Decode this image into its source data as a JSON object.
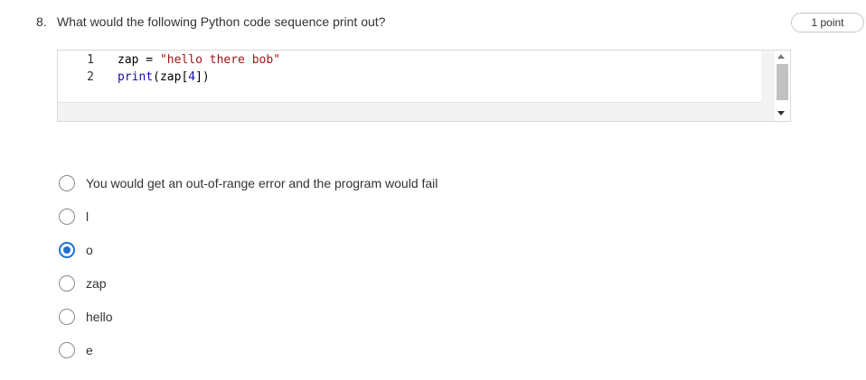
{
  "question": {
    "number": "8.",
    "text": "What would the following Python code sequence print out?",
    "points": "1 point"
  },
  "code": {
    "lines": [
      {
        "number": "1",
        "text": "zap = \"hello there bob\""
      },
      {
        "number": "2",
        "text": "print(zap[4])"
      }
    ]
  },
  "options": [
    {
      "label": "You would get an out-of-range error and the program would fail",
      "selected": false
    },
    {
      "label": "l",
      "selected": false
    },
    {
      "label": "o",
      "selected": true
    },
    {
      "label": "zap",
      "selected": false
    },
    {
      "label": "hello",
      "selected": false
    },
    {
      "label": "e",
      "selected": false
    }
  ],
  "colors": {
    "accent": "#1f6fd1",
    "string": "#a31515",
    "keyword": "#1a0dab"
  }
}
